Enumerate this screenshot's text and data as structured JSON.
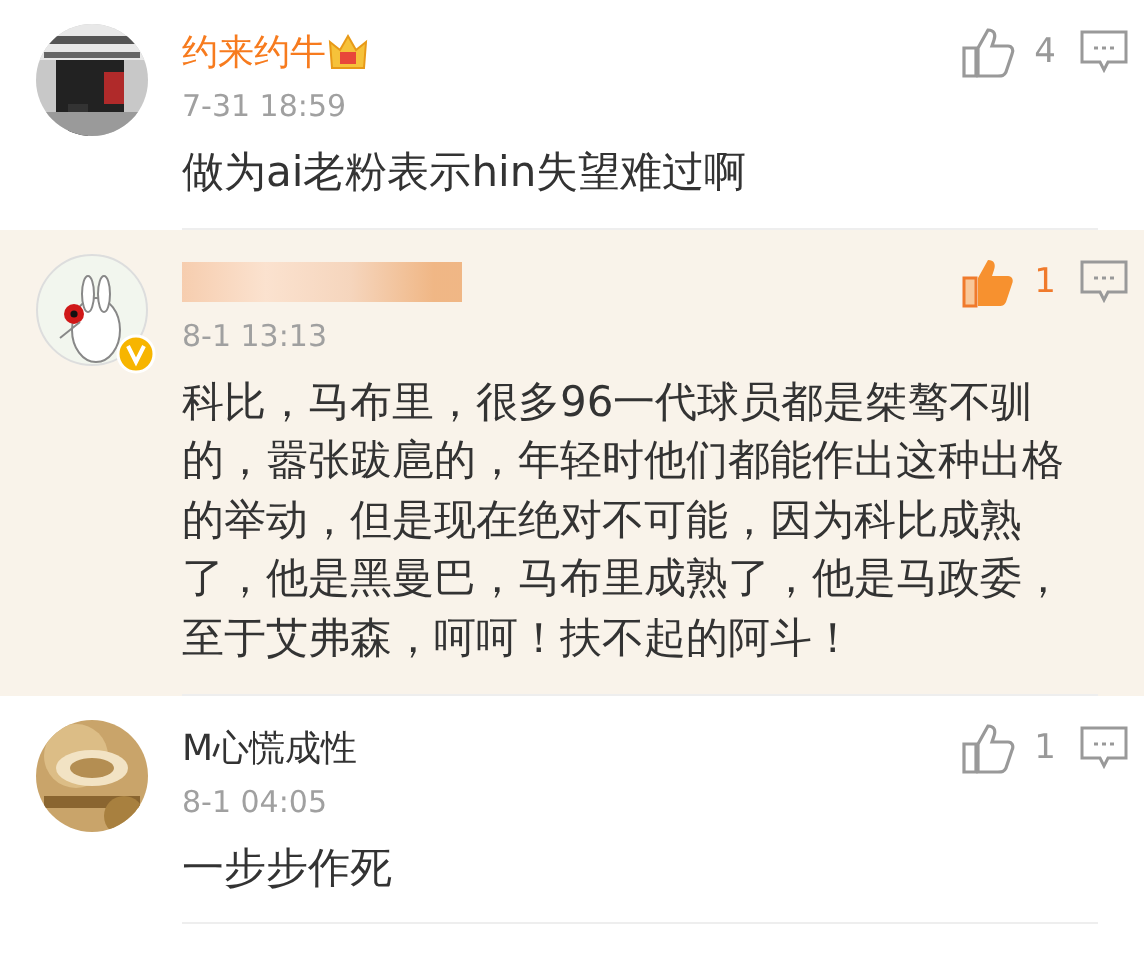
{
  "comments": [
    {
      "user": {
        "name": "约来约牛",
        "vip": true,
        "verified": false,
        "name_hidden": false
      },
      "time": "7-31 18:59",
      "text": "做为ai老粉表示hin失望难过啊",
      "likes": "4",
      "liked": false,
      "highlighted": false
    },
    {
      "user": {
        "name_hidden": true,
        "vip": false,
        "verified": true
      },
      "time": "8-1 13:13",
      "text": "科比，马布里，很多96一代球员都是桀骜不驯的，嚣张跋扈的，年轻时他们都能作出这种出格的举动，但是现在绝对不可能，因为科比成熟了，他是黑曼巴，马布里成熟了，他是马政委，至于艾弗森，呵呵！扶不起的阿斗！",
      "likes": "1",
      "liked": true,
      "highlighted": true
    },
    {
      "user": {
        "name": "M心慌成性",
        "vip": false,
        "verified": false,
        "name_hidden": false
      },
      "time": "8-1 04:05",
      "text": "一步步作死",
      "likes": "1",
      "liked": false,
      "highlighted": false
    }
  ]
}
